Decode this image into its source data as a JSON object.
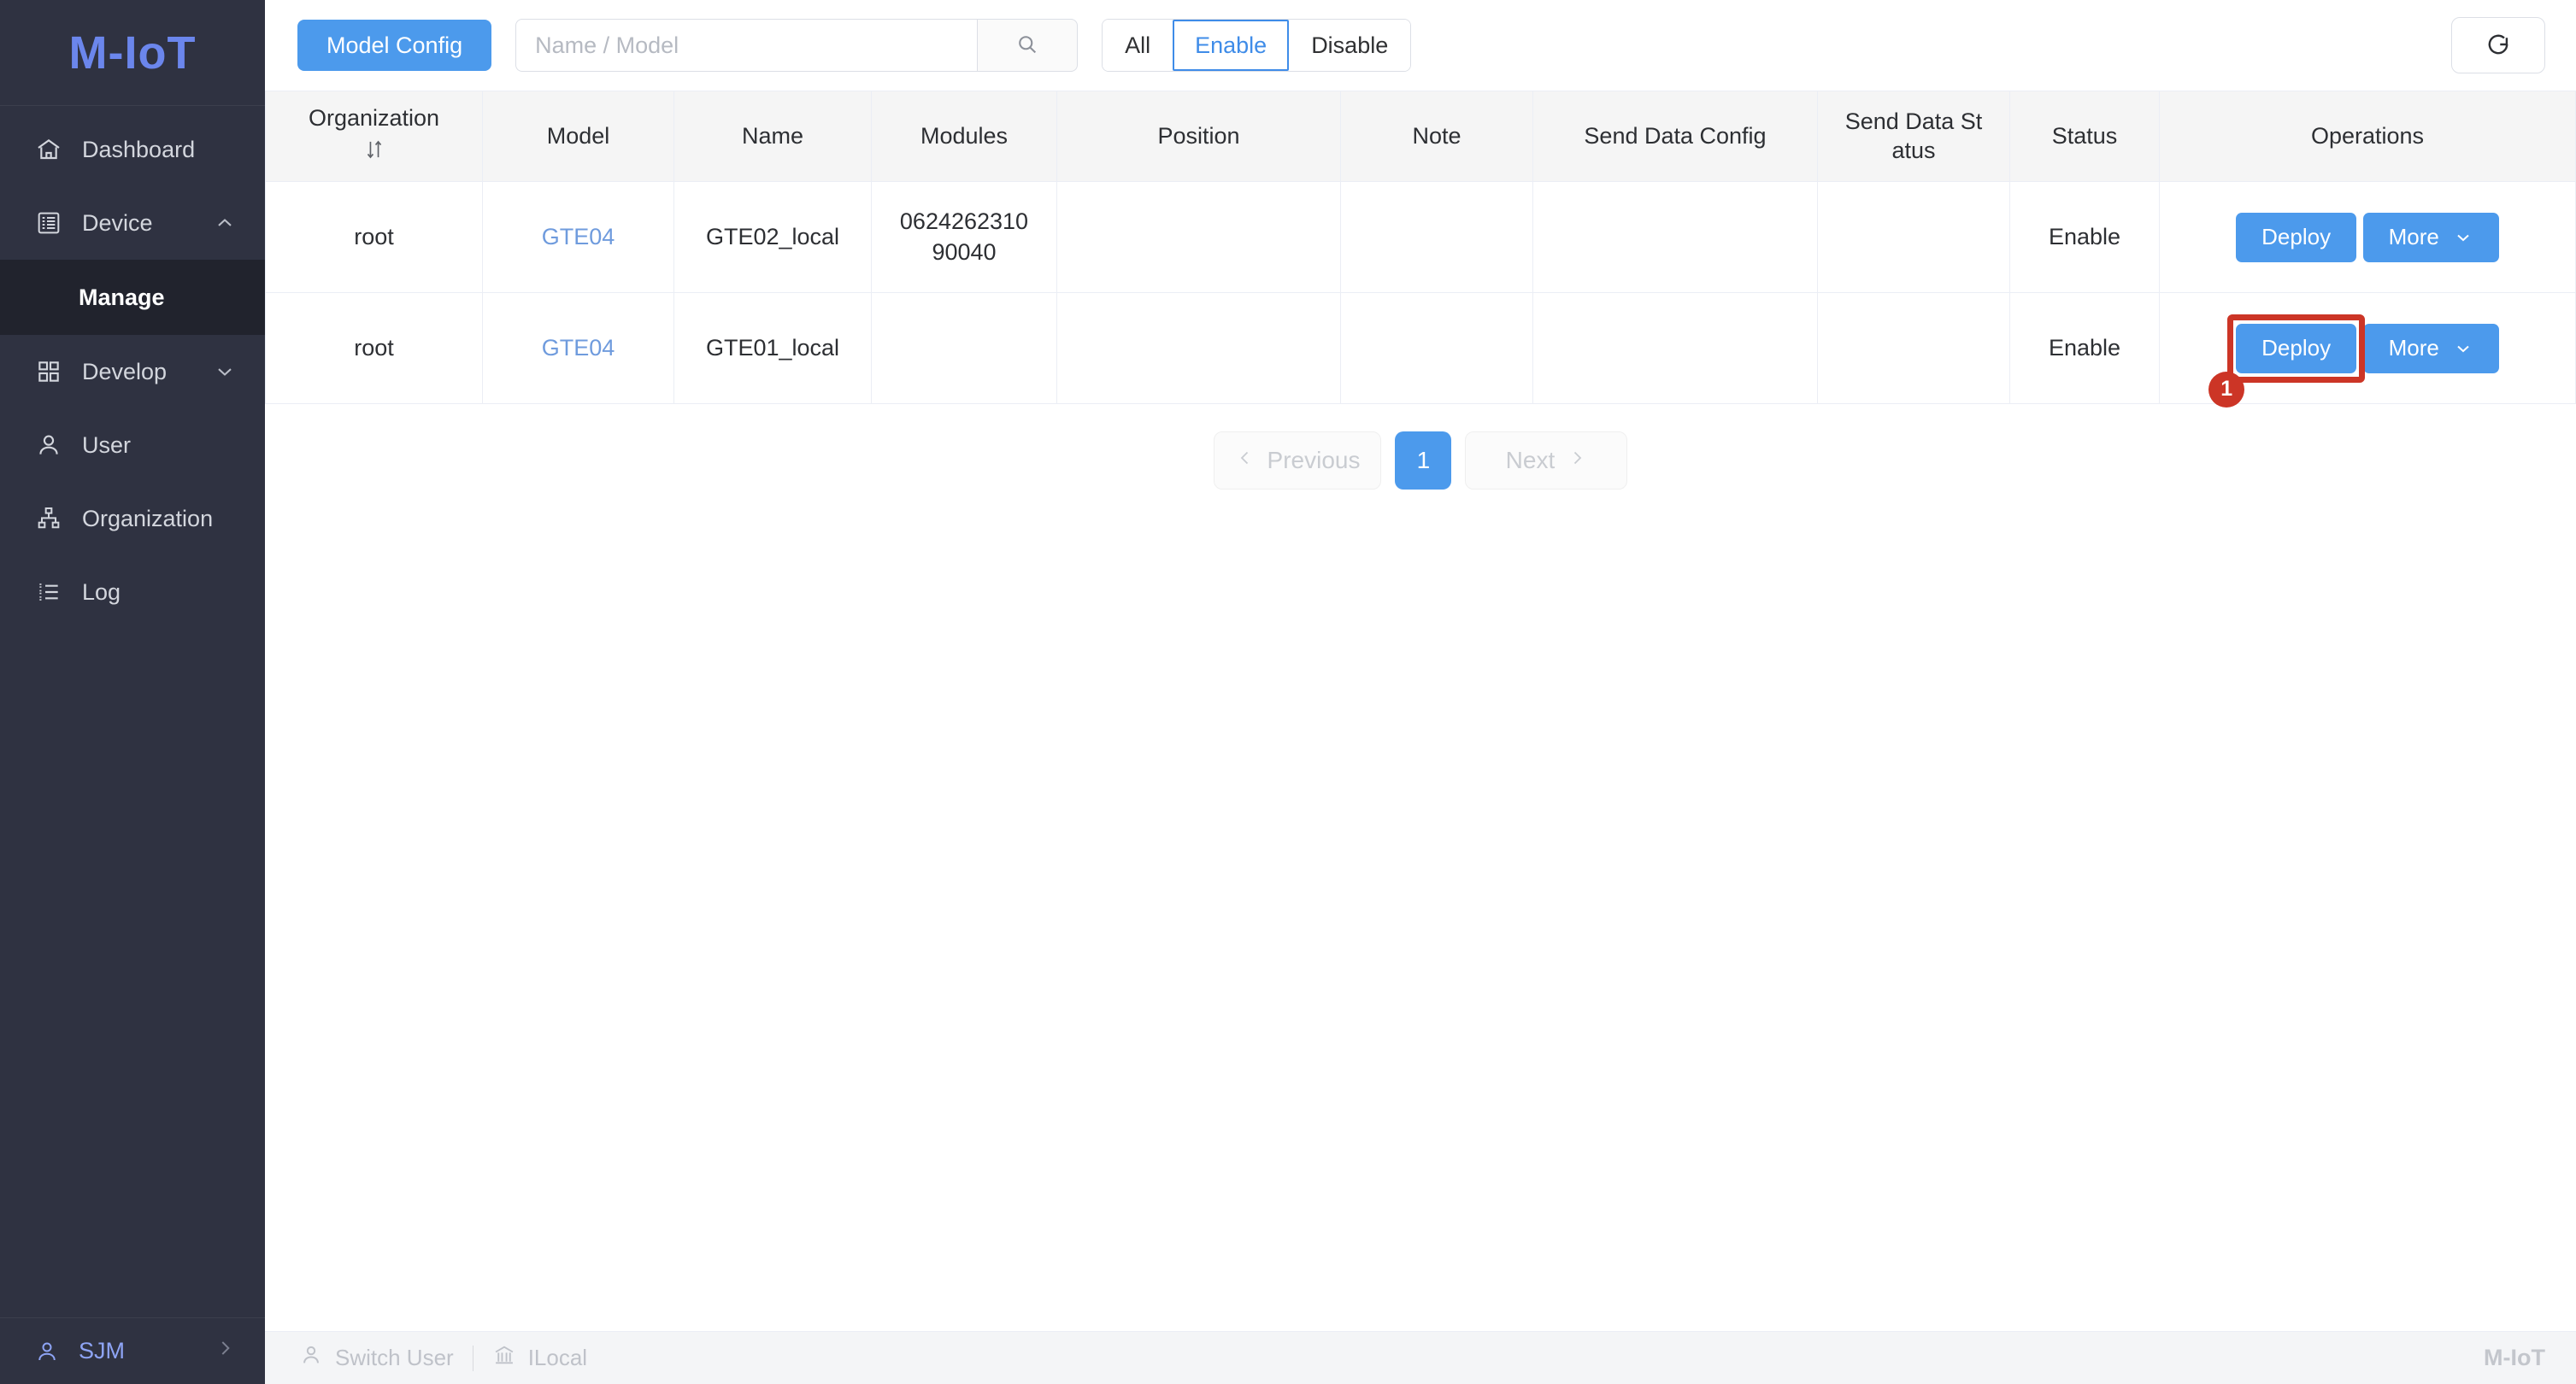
{
  "sidebar": {
    "brand": "M-IoT",
    "items": [
      {
        "label": "Dashboard",
        "icon": "home-icon",
        "expandable": false
      },
      {
        "label": "Device",
        "icon": "device-icon",
        "expandable": true,
        "chevron": "chevron-up-icon"
      },
      {
        "label": "Develop",
        "icon": "grid-icon",
        "expandable": true,
        "chevron": "chevron-down-icon"
      },
      {
        "label": "User",
        "icon": "user-icon",
        "expandable": false
      },
      {
        "label": "Organization",
        "icon": "org-tree-icon",
        "expandable": false
      },
      {
        "label": "Log",
        "icon": "list-icon",
        "expandable": false
      }
    ],
    "sub_item": "Manage",
    "user": {
      "name": "SJM",
      "icon": "user-icon",
      "chevron": "chevron-right-icon"
    }
  },
  "toolbar": {
    "model_config_label": "Model Config",
    "search_placeholder": "Name / Model",
    "search_value": "",
    "search_icon": "search-icon",
    "filters": [
      {
        "label": "All",
        "active": false
      },
      {
        "label": "Enable",
        "active": true
      },
      {
        "label": "Disable",
        "active": false
      }
    ],
    "refresh_icon": "refresh-icon"
  },
  "table": {
    "columns": [
      {
        "key": "organization",
        "label": "Organization",
        "sortable": true,
        "sort_icon": "sort-icon"
      },
      {
        "key": "model",
        "label": "Model"
      },
      {
        "key": "name",
        "label": "Name"
      },
      {
        "key": "modules",
        "label": "Modules"
      },
      {
        "key": "position",
        "label": "Position"
      },
      {
        "key": "note",
        "label": "Note"
      },
      {
        "key": "send_data_config",
        "label": "Send Data Config"
      },
      {
        "key": "send_data_status",
        "label": "Send Data St atus"
      },
      {
        "key": "status",
        "label": "Status"
      },
      {
        "key": "operations",
        "label": "Operations"
      }
    ],
    "rows": [
      {
        "organization": "root",
        "model": "GTE04",
        "name": "GTE02_local",
        "modules": "0624262310 90040",
        "position": "",
        "note": "",
        "send_data_config": "",
        "send_data_status": "",
        "status": "Enable",
        "deploy_label": "Deploy",
        "more_label": "More",
        "highlighted": false
      },
      {
        "organization": "root",
        "model": "GTE04",
        "name": "GTE01_local",
        "modules": "",
        "position": "",
        "note": "",
        "send_data_config": "",
        "send_data_status": "",
        "status": "Enable",
        "deploy_label": "Deploy",
        "more_label": "More",
        "highlighted": true,
        "highlight_badge": "1"
      }
    ]
  },
  "pagination": {
    "previous_label": "Previous",
    "next_label": "Next",
    "current_page": "1",
    "prev_icon": "chevron-left-icon",
    "next_icon": "chevron-right-icon"
  },
  "footer": {
    "switch_user_label": "Switch User",
    "switch_user_icon": "user-icon",
    "org_label": "ILocal",
    "org_icon": "bank-icon",
    "brand": "M-IoT"
  },
  "colors": {
    "sidebar_bg": "#2f3241",
    "sidebar_active_bg": "#21232d",
    "brand": "#6b86ec",
    "primary": "#4c9aec",
    "link": "#6f9bdd",
    "highlight": "#cc3526",
    "header_bg": "#f5f5f5"
  }
}
